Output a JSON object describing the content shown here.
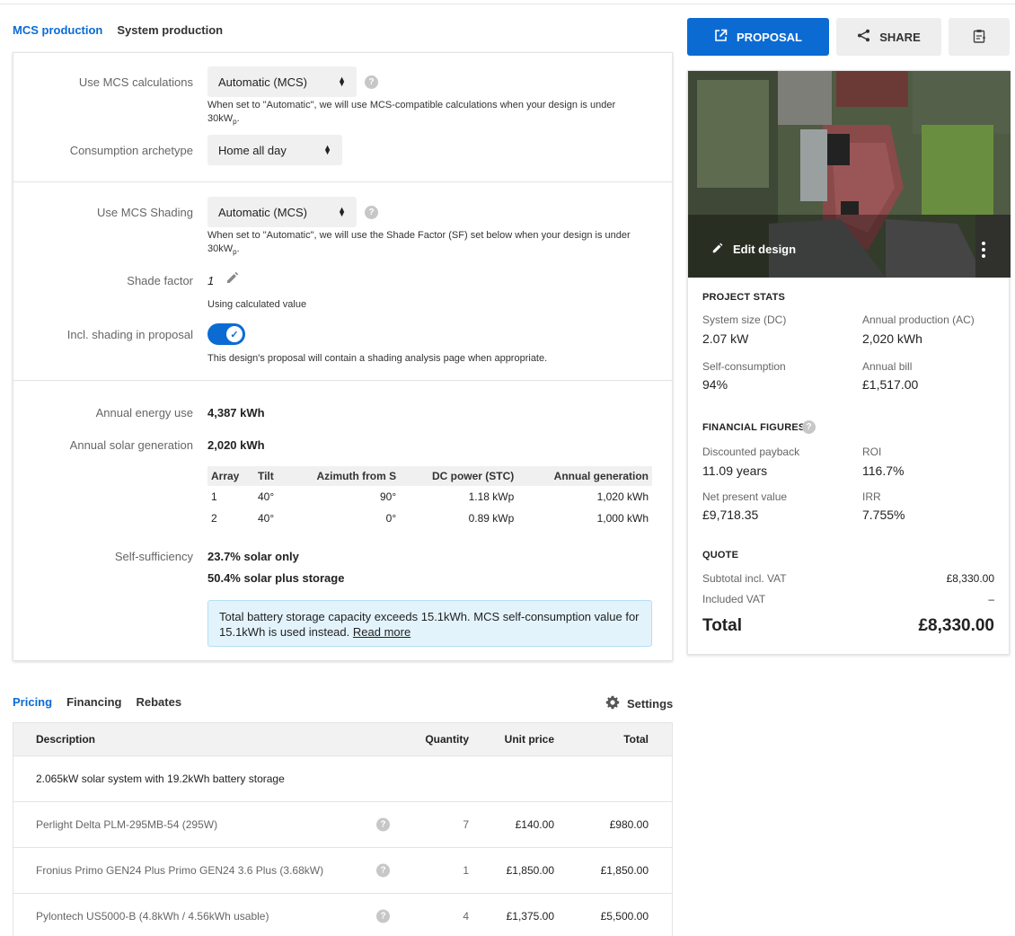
{
  "production_tabs": [
    {
      "label": "MCS production",
      "active": true
    },
    {
      "label": "System production",
      "active": false
    }
  ],
  "mcs": {
    "use_mcs_calc_label": "Use MCS calculations",
    "use_mcs_calc_value": "Automatic (MCS)",
    "use_mcs_calc_hint": "When set to \"Automatic\", we will use MCS-compatible calculations when your design is under",
    "use_mcs_calc_hint_unit": "30kW",
    "use_mcs_calc_hint_sub": "p",
    "use_mcs_calc_hint_end": ".",
    "archetype_label": "Consumption archetype",
    "archetype_value": "Home all day",
    "shading_label": "Use MCS Shading",
    "shading_value": "Automatic (MCS)",
    "shading_hint": "When set to \"Automatic\", we will use the Shade Factor (SF) set below when your design is under",
    "shading_hint_unit": "30kW",
    "shading_hint_sub": "p",
    "shading_hint_end": ".",
    "shade_factor_label": "Shade factor",
    "shade_factor_value": "1",
    "shade_factor_hint": "Using calculated value",
    "incl_shading_label": "Incl. shading in proposal",
    "incl_shading_on": true,
    "incl_shading_hint": "This design's proposal will contain a shading analysis page when appropriate."
  },
  "energy": {
    "annual_use_label": "Annual energy use",
    "annual_use_value": "4,387 kWh",
    "annual_gen_label": "Annual solar generation",
    "annual_gen_value": "2,020 kWh",
    "array_headers": [
      "Array",
      "Tilt",
      "Azimuth from S",
      "DC power (STC)",
      "Annual generation"
    ],
    "arrays": [
      [
        "1",
        "40°",
        "90°",
        "1.18 kWp",
        "1,020 kWh"
      ],
      [
        "2",
        "40°",
        "0°",
        "0.89 kWp",
        "1,000 kWh"
      ]
    ],
    "self_sufficiency_label": "Self-sufficiency",
    "self_sufficiency_solar": "23.7% solar only",
    "self_sufficiency_storage": "50.4% solar plus storage",
    "notice_text": "Total battery storage capacity exceeds 15.1kWh. MCS self-consumption value for 15.1kWh is used instead.",
    "notice_link": "Read more"
  },
  "pricing_tabs": [
    {
      "label": "Pricing",
      "active": true
    },
    {
      "label": "Financing",
      "active": false
    },
    {
      "label": "Rebates",
      "active": false
    }
  ],
  "settings_label": "Settings",
  "pricing": {
    "headers": {
      "description": "Description",
      "quantity": "Quantity",
      "unit_price": "Unit price",
      "total": "Total"
    },
    "group_title": "2.065kW solar system with 19.2kWh battery storage",
    "items": [
      {
        "description": "Perlight Delta PLM-295MB-54 (295W)",
        "quantity": "7",
        "unit_price": "£140.00",
        "total": "£980.00"
      },
      {
        "description": "Fronius Primo GEN24 Plus Primo GEN24 3.6 Plus (3.68kW)",
        "quantity": "1",
        "unit_price": "£1,850.00",
        "total": "£1,850.00"
      },
      {
        "description": "Pylontech US5000-B (4.8kWh / 4.56kWh usable)",
        "quantity": "4",
        "unit_price": "£1,375.00",
        "total": "£5,500.00"
      }
    ]
  },
  "actions": {
    "proposal": "PROPOSAL",
    "share": "SHARE"
  },
  "design": {
    "edit_label": "Edit design"
  },
  "project_stats": {
    "title": "PROJECT STATS",
    "system_size_label": "System size (DC)",
    "system_size_value": "2.07 kW",
    "annual_production_label": "Annual production (AC)",
    "annual_production_value": "2,020 kWh",
    "self_consumption_label": "Self-consumption",
    "self_consumption_value": "94%",
    "annual_bill_label": "Annual bill",
    "annual_bill_value": "£1,517.00"
  },
  "financial": {
    "title": "FINANCIAL FIGURES",
    "payback_label": "Discounted payback",
    "payback_value": "11.09 years",
    "roi_label": "ROI",
    "roi_value": "116.7%",
    "npv_label": "Net present value",
    "npv_value": "£9,718.35",
    "irr_label": "IRR",
    "irr_value": "7.755%"
  },
  "quote": {
    "title": "QUOTE",
    "subtotal_label": "Subtotal incl. VAT",
    "subtotal_value": "£8,330.00",
    "vat_label": "Included VAT",
    "vat_value": "–",
    "total_label": "Total",
    "total_value": "£8,330.00"
  },
  "colors": {
    "accent": "#0b6bd3",
    "notice_bg": "#e3f3fc"
  }
}
